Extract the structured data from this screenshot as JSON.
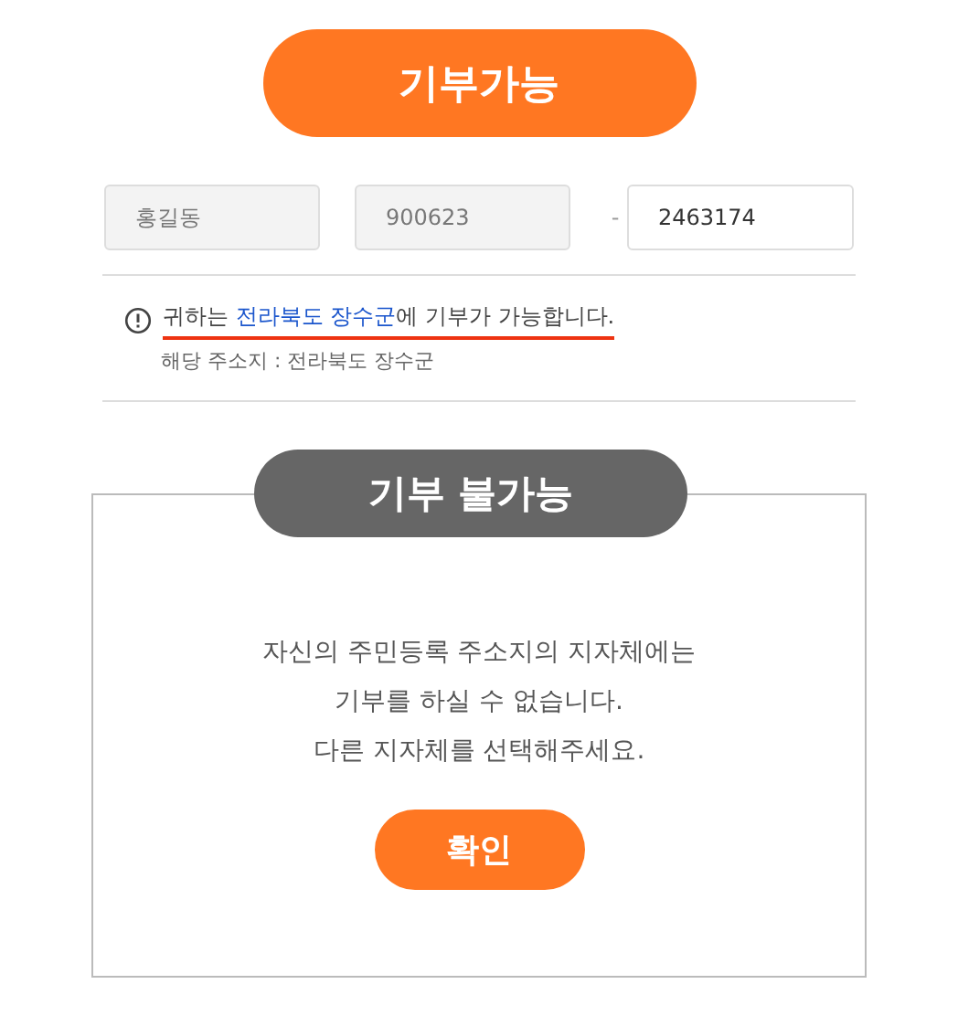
{
  "header_button": {
    "label": "기부가능"
  },
  "fields": [
    {
      "value": "홍길동",
      "disabled": true
    },
    {
      "value": "900623",
      "disabled": true
    },
    {
      "value": "2463174",
      "disabled": false
    }
  ],
  "separator": "-",
  "notice": {
    "prefix": "귀하는 ",
    "highlight": "전라북도 장수군",
    "suffix": "에 기부가 가능합니다.",
    "detail": "해당 주소지 : 전라북도 장수군"
  },
  "dialog": {
    "title": "기부 불가능",
    "lines": [
      "자신의 주민등록 주소지의 지자체에는",
      "기부를 하실 수 없습니다.",
      "다른 지자체를 선택해주세요."
    ],
    "confirm": "확인"
  }
}
